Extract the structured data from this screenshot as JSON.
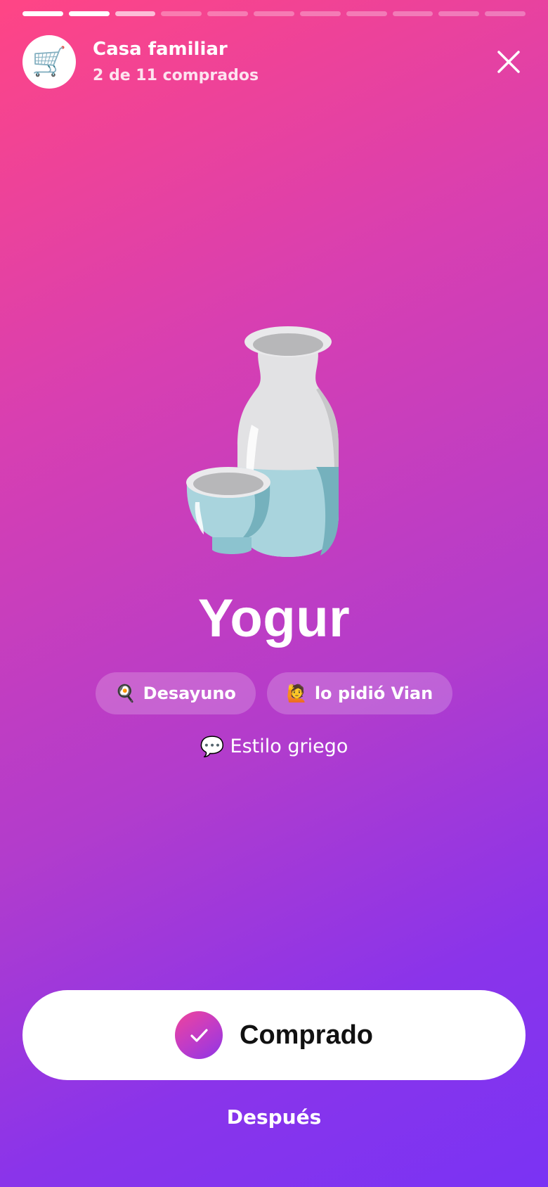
{
  "progress": {
    "total_segments": 11,
    "done_segments": 2,
    "current_segment": 3
  },
  "header": {
    "avatar_icon": "shopping-cart-icon",
    "avatar_emoji": "🛒",
    "list_name": "Casa familiar",
    "progress_text": "2 de 11 comprados",
    "close_icon": "close-icon"
  },
  "item": {
    "illustration": "sake-bottle-and-cup",
    "name": "Yogur",
    "tags": [
      {
        "emoji": "🍳",
        "label": "Desayuno"
      },
      {
        "emoji": "🙋",
        "label": "lo pidió Vian"
      }
    ],
    "note_emoji": "💬",
    "note": "Estilo griego"
  },
  "actions": {
    "bought_label": "Comprado",
    "later_label": "Después"
  },
  "colors": {
    "gradient_start": "#ff4585",
    "gradient_end": "#7a33f4",
    "button_bg": "#ffffff",
    "button_text": "#111111"
  }
}
